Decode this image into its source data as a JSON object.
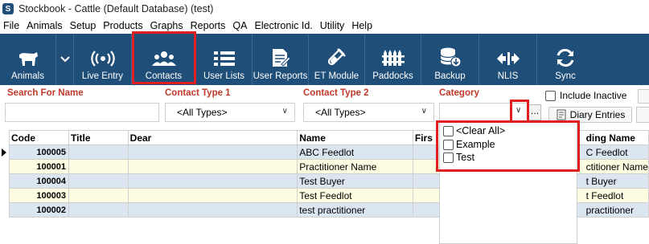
{
  "window": {
    "title": "Stockbook - Cattle (Default Database) (test)"
  },
  "menu": [
    "File",
    "Animals",
    "Setup",
    "Products",
    "Graphs",
    "Reports",
    "QA",
    "Electronic Id.",
    "Utility",
    "Help"
  ],
  "toolbar": {
    "animals": "Animals",
    "live_entry": "Live Entry",
    "contacts": "Contacts",
    "user_lists": "User Lists",
    "user_reports": "User Reports",
    "et_module": "ET Module",
    "paddocks": "Paddocks",
    "backup": "Backup",
    "nlis": "NLIS",
    "sync": "Sync"
  },
  "filters": {
    "search_label": "Search For Name",
    "search_value": "",
    "type1_label": "Contact Type 1",
    "type1_value": "<All Types>",
    "type2_label": "Contact Type 2",
    "type2_value": "<All Types>",
    "category_label": "Category",
    "category_value": "",
    "include_inactive": "Include Inactive",
    "diary_entries": "Diary Entries",
    "ellipsis": "…"
  },
  "category_dropdown": {
    "items": [
      "<Clear All>",
      "Example",
      "Test"
    ]
  },
  "table": {
    "headers": [
      "Code",
      "Title",
      "Dear",
      "Name",
      "Firs",
      "ding Name"
    ],
    "rows": [
      {
        "code": "100005",
        "title": "",
        "dear": "",
        "name": "ABC Feedlot",
        "tail": "C Feedlot"
      },
      {
        "code": "100001",
        "title": "",
        "dear": "",
        "name": "Practitioner Name",
        "tail": "ctitioner Name"
      },
      {
        "code": "100004",
        "title": "",
        "dear": "",
        "name": "Test Buyer",
        "tail": "t Buyer"
      },
      {
        "code": "100003",
        "title": "",
        "dear": "",
        "name": "Test Feedlot",
        "tail": "t Feedlot"
      },
      {
        "code": "100002",
        "title": "",
        "dear": "",
        "name": "test practitioner",
        "tail": "practitioner"
      }
    ]
  },
  "colors": {
    "toolbar": "#1f4e79",
    "highlight": "#e02020",
    "label": "#c0392b",
    "row_blue": "#dbe6f1",
    "row_yellow": "#fffde1"
  }
}
